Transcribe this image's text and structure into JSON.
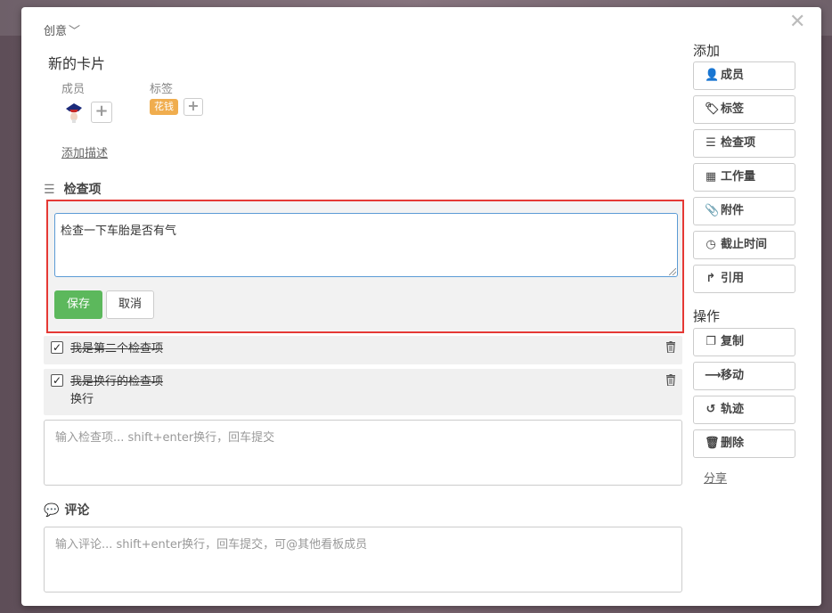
{
  "card": {
    "list_name": "创意",
    "title": "新的卡片",
    "members_label": "成员",
    "labels_label": "标签",
    "tag": "花钱",
    "add_description": "添加描述"
  },
  "checklist": {
    "heading": "检查项",
    "editor_value": "检查一下车胎是否有气",
    "save_label": "保存",
    "cancel_label": "取消",
    "items": [
      {
        "text": "我是第二个检查项",
        "extra": "",
        "checked": true
      },
      {
        "text": "我是换行的检查项",
        "extra": "换行",
        "checked": true
      }
    ],
    "new_item_placeholder": "输入检查项... shift+enter换行，回车提交"
  },
  "comments": {
    "heading": "评论",
    "placeholder": "输入评论... shift+enter换行，回车提交，可@其他看板成员"
  },
  "sidebar": {
    "add_title": "添加",
    "add_buttons": [
      {
        "label": "成员",
        "icon": "add-user-icon"
      },
      {
        "label": "标签",
        "icon": "tag-icon"
      },
      {
        "label": "检查项",
        "icon": "list-icon"
      },
      {
        "label": "工作量",
        "icon": "grid-icon"
      },
      {
        "label": "附件",
        "icon": "paperclip-icon"
      },
      {
        "label": "截止时间",
        "icon": "clock-icon"
      },
      {
        "label": "引用",
        "icon": "share-arrow-icon"
      }
    ],
    "actions_title": "操作",
    "action_buttons": [
      {
        "label": "复制",
        "icon": "copy-icon"
      },
      {
        "label": "移动",
        "icon": "arrow-right-icon"
      },
      {
        "label": "轨迹",
        "icon": "history-icon"
      },
      {
        "label": "删除",
        "icon": "trash-icon"
      }
    ],
    "share_label": "分享"
  },
  "colors": {
    "save_green": "#5cb85c",
    "tag_orange": "#f0ad4e",
    "highlight_red": "#e53935",
    "focus_blue": "#5b9bd5"
  }
}
